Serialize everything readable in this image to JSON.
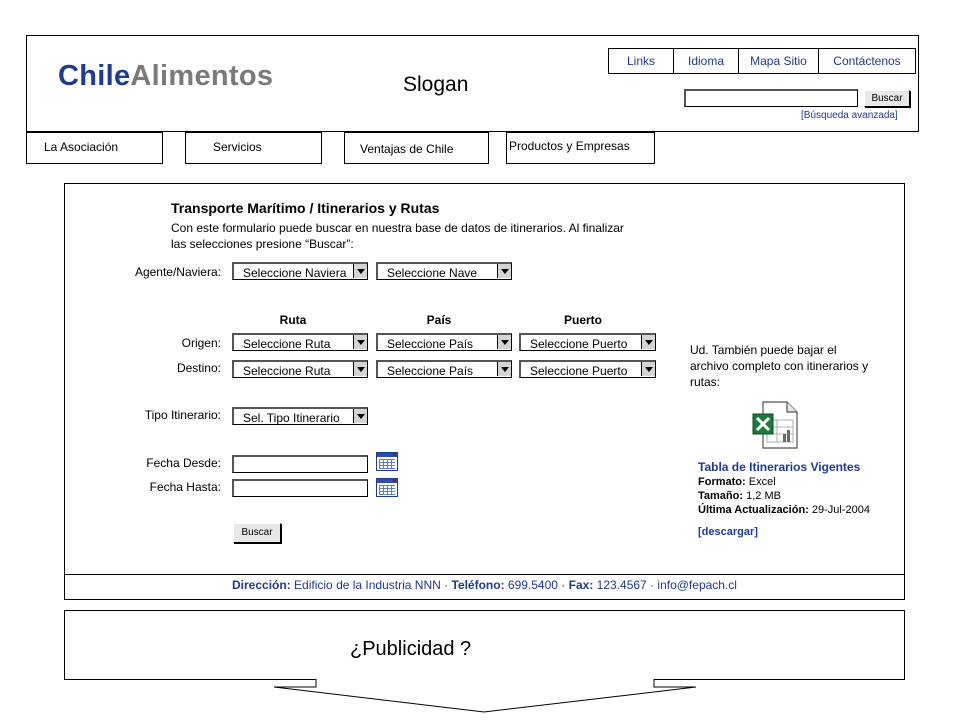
{
  "header": {
    "logo_part1": "Chile",
    "logo_part2": "Alimentos",
    "slogan": "Slogan",
    "top_links": [
      "Links",
      "Idioma",
      "Mapa Sitio",
      "Contáctenos"
    ],
    "search_button": "Buscar",
    "advanced_search": "[Búsqueda avanzada]"
  },
  "nav": {
    "tabs": [
      "La Asociación",
      "Servicios",
      "Ventajas de Chile",
      "Productos y Empresas"
    ]
  },
  "form": {
    "title": "Transporte Marítimo / Itinerarios y Rutas",
    "description": "Con este formulario puede buscar en nuestra base de datos de itinerarios. Al finalizar las selecciones presione “Buscar”:",
    "agente_label": "Agente/Naviera:",
    "agente_select": "Seleccione Naviera",
    "nave_select": "Seleccione Nave",
    "col_ruta": "Ruta",
    "col_pais": "País",
    "col_puerto": "Puerto",
    "origen_label": "Origen:",
    "destino_label": "Destino:",
    "ruta_select": "Seleccione Ruta",
    "pais_select": "Seleccione País",
    "puerto_select": "Seleccione Puerto",
    "tipo_label": "Tipo Itinerario:",
    "tipo_select": "Sel. Tipo Itinerario",
    "fecha_desde_label": "Fecha Desde:",
    "fecha_hasta_label": "Fecha Hasta:",
    "buscar_button": "Buscar"
  },
  "download": {
    "intro": "Ud. También puede bajar el archivo completo con itinerarios y rutas:",
    "icon": "excel-file-icon",
    "title": "Tabla de Itinerarios Vigentes",
    "formato_label": "Formato:",
    "formato_value": "Excel",
    "tamano_label": "Tamaño:",
    "tamano_value": "1,2 MB",
    "actualizacion_label": "Última Actualización:",
    "actualizacion_value": "29-Jul-2004",
    "link": "[descargar]"
  },
  "footer": {
    "direccion_label": "Dirección:",
    "direccion_value": "Edificio de la Industria NNN",
    "telefono_label": "Teléfono:",
    "telefono_value": "699.5400",
    "fax_label": "Fax:",
    "fax_value": "123.4567",
    "email": "info@fepach.cl"
  },
  "advertising": {
    "text": "¿Publicidad ?"
  },
  "colors": {
    "brand_blue": "#1f3a93",
    "brand_gray": "#7a7a7a"
  }
}
